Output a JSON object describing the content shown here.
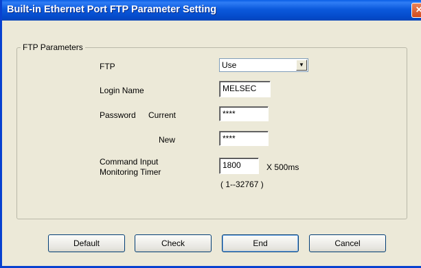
{
  "window": {
    "title": "Built-in Ethernet Port FTP Parameter Setting",
    "close_label": "×"
  },
  "group": {
    "legend": "FTP Parameters"
  },
  "ftp": {
    "label": "FTP",
    "value": "Use"
  },
  "login": {
    "label": "Login Name",
    "value": "MELSEC"
  },
  "password": {
    "label": "Password",
    "current_label": "Current",
    "current_value": "****",
    "new_label": "New",
    "new_value": "****"
  },
  "timer": {
    "label_line1": "Command Input",
    "label_line2": "Monitoring Timer",
    "value": "1800",
    "unit": "X 500ms",
    "range": "( 1--32767 )"
  },
  "buttons": {
    "default": "Default",
    "check": "Check",
    "end": "End",
    "cancel": "Cancel"
  }
}
